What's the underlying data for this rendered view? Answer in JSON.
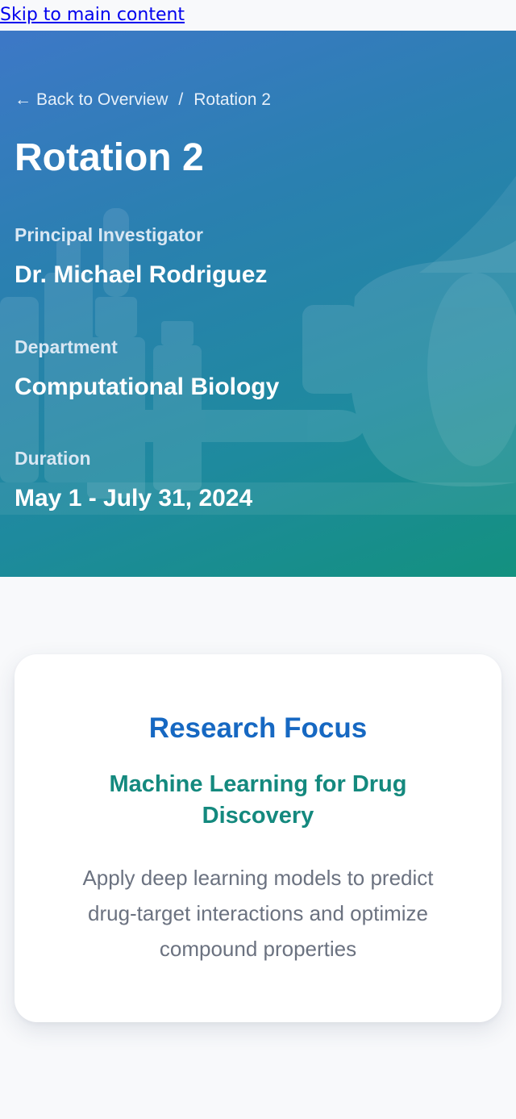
{
  "skip_link": "Skip to main content",
  "breadcrumb": {
    "back_label": "Back to Overview",
    "separator": "/",
    "current": "Rotation 2"
  },
  "hero": {
    "title": "Rotation 2",
    "pi_label": "Principal Investigator",
    "pi_value": "Dr. Michael Rodriguez",
    "department_label": "Department",
    "department_value": "Computational Biology",
    "duration_label": "Duration",
    "duration_value": "May 1 - July 31, 2024"
  },
  "research": {
    "heading": "Research Focus",
    "subheading": "Machine Learning for Drug Discovery",
    "description": "Apply deep learning models to predict drug-target interactions and optimize compound properties"
  },
  "colors": {
    "hero_gradient_start": "#3d78c7",
    "hero_gradient_end": "#13917f",
    "heading_blue": "#1668c2",
    "subheading_teal": "#14897e",
    "body_gray": "#6b7280"
  }
}
